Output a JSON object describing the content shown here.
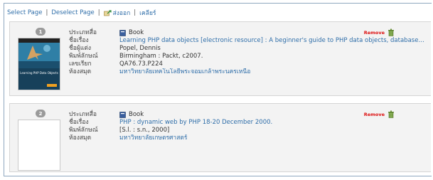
{
  "toolbar": {
    "select_page": "Select Page",
    "deselect_page": "Deselect Page",
    "export": "ส่งออก",
    "clear": "เคลียร์"
  },
  "records": [
    {
      "index": "1",
      "labels": [
        "ประเภทสื่อ",
        "ชื่อเรื่อง",
        "ชื่อผู้แต่ง",
        "พิมพ์ลักษณ์",
        "เลขเรียก",
        "ห้องสมุด"
      ],
      "type": "Book",
      "title": "Learning PHP data objects [electronic resource] : A beginner's guide to PHP data objects, database c...",
      "author": "Popel, Dennis",
      "imprint": "Birmingham : Packt, c2007.",
      "call_number": "QA76.73.P224",
      "library": "มหาวิทยาลัยเทคโนโลยีพระจอมเกล้าพระนครเหนือ",
      "remove_label": "Remove",
      "cover_text": "Learning PHP Data Objects"
    },
    {
      "index": "2",
      "labels": [
        "ประเภทสื่อ",
        "ชื่อเรื่อง",
        "พิมพ์ลักษณ์",
        "ห้องสมุด"
      ],
      "type": "Book",
      "title": "PHP : dynamic web by PHP 18-20 December 2000.",
      "imprint": "[S.l. : s.n., 2000]",
      "library": "มหาวิทยาลัยเกษตรศาสตร์",
      "remove_label": "Remove"
    }
  ],
  "colors": {
    "link": "#2f6ea9",
    "remove": "#dd1111",
    "frame_border": "#8fa8bf",
    "record_bg": "#f3f3f3"
  }
}
